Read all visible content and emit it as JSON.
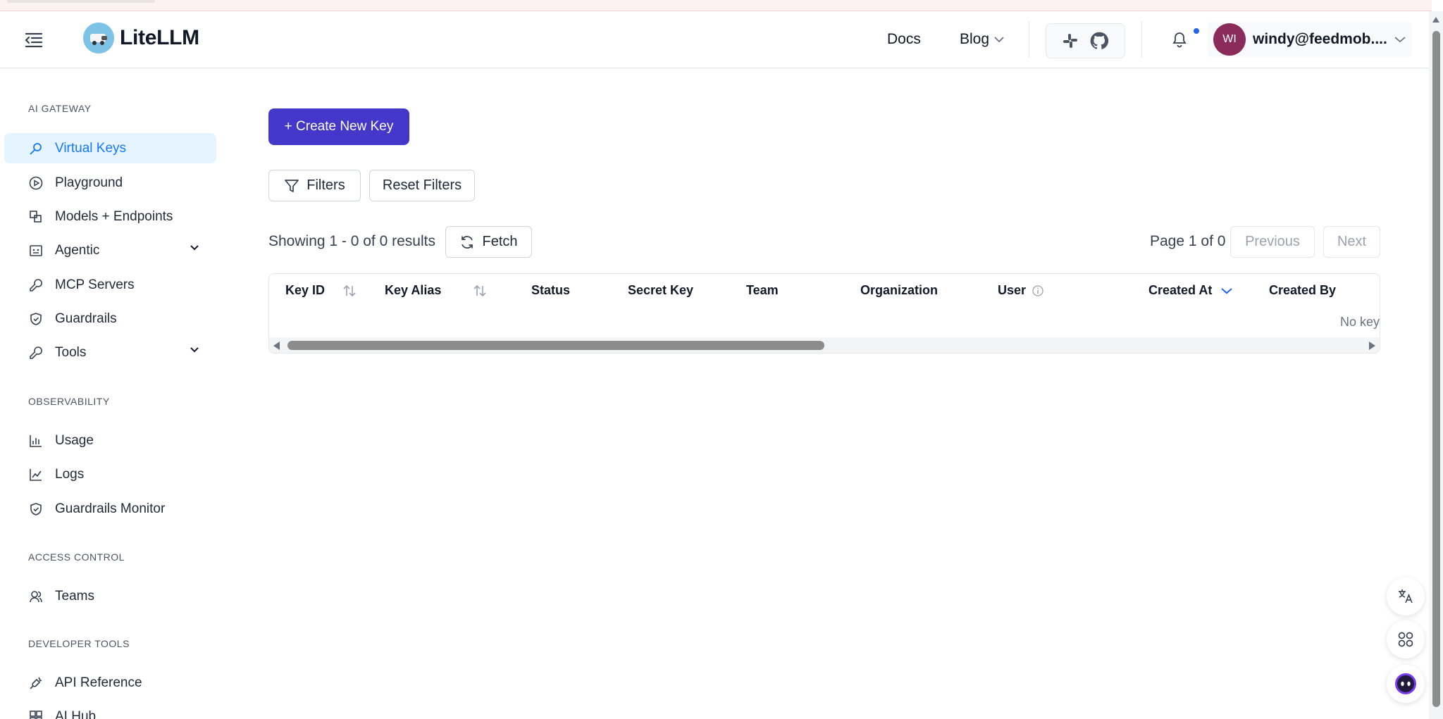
{
  "app": {
    "name": "LiteLLM"
  },
  "header": {
    "docs": "Docs",
    "blog": "Blog",
    "avatar_initials": "WI",
    "user_email": "windy@feedmob...."
  },
  "sidebar": {
    "sections": [
      {
        "title": "AI GATEWAY",
        "items": [
          {
            "label": "Virtual Keys",
            "icon": "key-icon",
            "active": true
          },
          {
            "label": "Playground",
            "icon": "play-circle-icon"
          },
          {
            "label": "Models + Endpoints",
            "icon": "block-icon"
          },
          {
            "label": "Agentic",
            "icon": "robot-icon",
            "expandable": true
          },
          {
            "label": "MCP Servers",
            "icon": "tool-icon"
          },
          {
            "label": "Guardrails",
            "icon": "shield-icon"
          },
          {
            "label": "Tools",
            "icon": "tool-icon",
            "expandable": true
          }
        ]
      },
      {
        "title": "OBSERVABILITY",
        "items": [
          {
            "label": "Usage",
            "icon": "bar-chart-icon"
          },
          {
            "label": "Logs",
            "icon": "line-chart-icon"
          },
          {
            "label": "Guardrails Monitor",
            "icon": "shield-icon"
          }
        ]
      },
      {
        "title": "ACCESS CONTROL",
        "items": [
          {
            "label": "Teams",
            "icon": "team-icon"
          }
        ]
      },
      {
        "title": "DEVELOPER TOOLS",
        "items": [
          {
            "label": "API Reference",
            "icon": "api-icon"
          },
          {
            "label": "AI Hub",
            "icon": "appstore-icon"
          }
        ]
      }
    ]
  },
  "main": {
    "create_button": "+ Create New Key",
    "filters_button": "Filters",
    "reset_filters_button": "Reset Filters",
    "showing_text": "Showing 1 - 0 of 0 results",
    "fetch_button": "Fetch",
    "page_info": "Page 1 of 0",
    "previous_button": "Previous",
    "next_button": "Next",
    "table": {
      "columns": [
        "Key ID",
        "Key Alias",
        "Status",
        "Secret Key",
        "Team",
        "Organization",
        "User",
        "Created At",
        "Created By"
      ],
      "empty_text": "No key"
    }
  },
  "colors": {
    "primary": "#4338ca",
    "active_bg": "#e6f4ff",
    "active_text": "#1677ff",
    "avatar": "#8b2b5c"
  }
}
